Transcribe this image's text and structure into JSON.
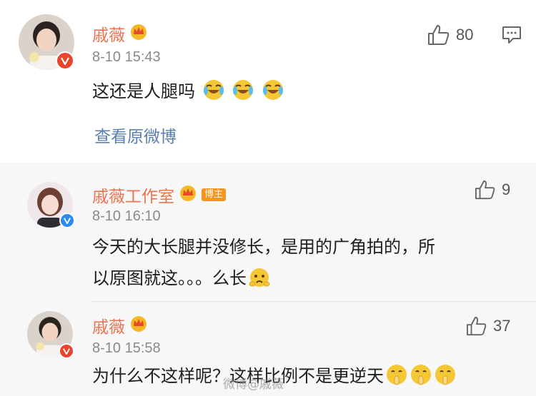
{
  "comments": [
    {
      "user": "戚薇",
      "time": "8-10 15:43",
      "text": "这还是人腿吗",
      "likes": "80",
      "view_link": "查看原微博",
      "emoji": "laugh-cry-icon"
    },
    {
      "user": "戚薇工作室",
      "tag": "博主",
      "time": "8-10 16:10",
      "text_line1": "今天的大长腿并没修长，是用的广角拍的，所",
      "text_line2": "以原图就这。。。么长",
      "likes": "9",
      "emoji": "worried-icon"
    },
    {
      "user": "戚薇",
      "time": "8-10 15:58",
      "text": "为什么不这样呢？这样比例不是更逆天",
      "likes": "37",
      "emoji": "shush-icon"
    }
  ],
  "watermark": "微博@戚薇",
  "colors": {
    "name": "#eb7350",
    "link": "#5a7fb0",
    "time": "#8a8a8a",
    "vip_badge": "#e8442e",
    "verified_blue": "#2d8cf0",
    "tag": "#f7931e"
  }
}
